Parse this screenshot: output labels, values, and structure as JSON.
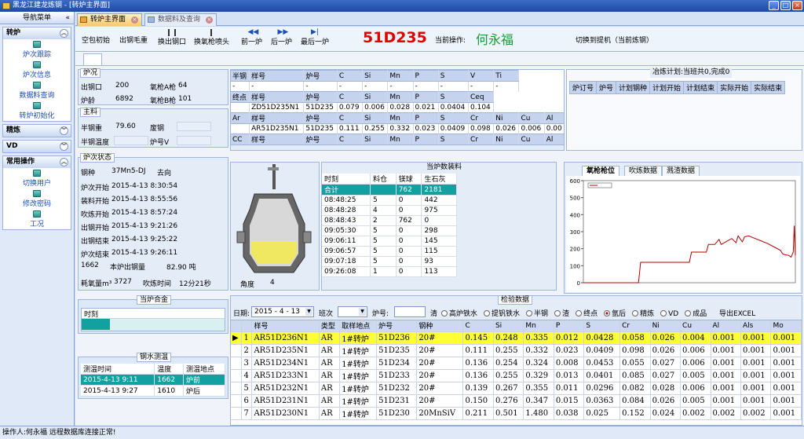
{
  "window": {
    "title": "黑龙江建龙炼钢 - [转炉主界面]"
  },
  "sidebar": {
    "title": "导航菜单",
    "groups": [
      {
        "label": "转炉",
        "items": [
          "炉次跟踪",
          "炉次信息",
          "数据料查询",
          "转炉初始化"
        ]
      },
      {
        "label": "精炼",
        "items": []
      },
      {
        "label": "VD",
        "items": []
      },
      {
        "label": "常用操作",
        "items": [
          "切换用户",
          "修改密码",
          "工况"
        ]
      }
    ]
  },
  "tabs": [
    {
      "label": "转炉主界面"
    },
    {
      "label": "数据料及查询"
    }
  ],
  "toolbar": {
    "buttons": [
      "空包初始",
      "出钢毛重",
      "换出钢口",
      "换氧枪喷头",
      "前一炉",
      "后一炉",
      "最后一炉"
    ],
    "heat_no": "51D235",
    "operator_label": "当前操作:",
    "operator": "何永福",
    "switch_label": "切换到提机（当前炼钢）"
  },
  "furnace_status": {
    "title": "炉况",
    "tap_label": "出钢口",
    "tap_value": "200",
    "lance_label": "氧枪A枪",
    "lance_value": "64",
    "age_label": "炉龄",
    "age_value": "6892",
    "lanceb_label": "氧枪B枪",
    "lanceb_value": "101"
  },
  "main_material": {
    "title": "主料",
    "hm_label": "半钢重",
    "hm_value": "79.60",
    "scrap_label": "废钢",
    "scrap_value": "",
    "temp_label": "半钢温度",
    "temp_value": "",
    "furnace_label": "炉号V",
    "furnace_value": ""
  },
  "heat_state": {
    "title": "炉次状态",
    "grade_label": "钢种",
    "grade_value": "37Mn5-DJ",
    "dest_label": "去向",
    "dest_value": "",
    "rows": [
      {
        "label": "炉次开始",
        "value": "2015-4-13 8:30:54"
      },
      {
        "label": "装料开始",
        "value": "2015-4-13 8:55:56"
      },
      {
        "label": "吹炼开始",
        "value": "2015-4-13 8:57:24"
      },
      {
        "label": "出钢开始",
        "value": "2015-4-13 9:21:26"
      },
      {
        "label": "出钢结束",
        "value": "2015-4-13 9:25:22"
      },
      {
        "label": "炉次结束",
        "value": "2015-4-13 9:26:11"
      }
    ],
    "steel_label": "本炉出钢量",
    "steel_value": "1662",
    "steel_weight": "82.90 吨",
    "oxygen_label": "耗氧量m³",
    "oxygen_value": "3727",
    "blow_label": "吹炼时间",
    "blow_value": "12分21秒"
  },
  "composition": {
    "header": [
      "半钢",
      "样号",
      "炉号",
      "C",
      "Si",
      "Mn",
      "P",
      "S",
      "V",
      "Ti"
    ],
    "row1": [
      "-",
      "-",
      "-",
      "-",
      "-",
      "-",
      "-",
      "-",
      "-",
      "-"
    ],
    "end_header": [
      "终点",
      "样号",
      "炉号",
      "C",
      "Si",
      "Mn",
      "P",
      "S",
      "Ceq"
    ],
    "end_row": [
      "",
      "ZD51D235N1",
      "51D235",
      "0.079",
      "0.006",
      "0.028",
      "0.021",
      "0.0404",
      "0.104"
    ],
    "ar_header": [
      "Ar",
      "样号",
      "炉号",
      "C",
      "Si",
      "Mn",
      "P",
      "S",
      "Cr",
      "Ni",
      "Cu",
      "Al"
    ],
    "ar_row": [
      "",
      "AR51D235N1",
      "51D235",
      "0.111",
      "0.255",
      "0.332",
      "0.023",
      "0.0409",
      "0.098",
      "0.026",
      "0.006",
      "0.00"
    ],
    "cc_header": [
      "CC",
      "样号",
      "炉号",
      "C",
      "Si",
      "Mn",
      "P",
      "S",
      "Cr",
      "Ni",
      "Cu",
      "Al"
    ]
  },
  "smelting_plan": {
    "title": "冶炼计划:当班共0,完成0",
    "columns": [
      "炉订号",
      "炉号",
      "计划钢种",
      "计划开始",
      "计划结束",
      "实际开始",
      "实际结束"
    ]
  },
  "converter": {
    "angle_label": "角度",
    "angle_value": "4"
  },
  "charge_data": {
    "title": "当炉数装料",
    "columns": [
      "时刻",
      "料仓",
      "镁球",
      "生石灰"
    ],
    "rows": [
      [
        "合计",
        "",
        "762",
        "2181"
      ],
      [
        "08:48:25",
        "5",
        "0",
        "442"
      ],
      [
        "08:48:28",
        "4",
        "0",
        "975"
      ],
      [
        "08:48:43",
        "2",
        "762",
        "0"
      ],
      [
        "09:05:30",
        "5",
        "0",
        "298"
      ],
      [
        "09:06:11",
        "5",
        "0",
        "145"
      ],
      [
        "09:06:57",
        "5",
        "0",
        "115"
      ],
      [
        "09:07:18",
        "5",
        "0",
        "93"
      ],
      [
        "09:26:08",
        "1",
        "0",
        "113"
      ]
    ]
  },
  "chart_tabs": [
    "氧枪枪位",
    "吹炼数据",
    "溅渣数据"
  ],
  "chart_data": {
    "type": "line",
    "title": "",
    "legend": "",
    "ylim": [
      0,
      600
    ],
    "yticks": [
      0,
      100,
      200,
      300,
      400,
      500,
      600
    ],
    "xticks": [],
    "series": [
      {
        "values": [
          [
            0,
            0
          ],
          [
            26,
            0
          ],
          [
            27,
            120
          ],
          [
            45,
            120
          ],
          [
            50,
            120
          ],
          [
            51,
            180
          ],
          [
            58,
            180
          ],
          [
            59,
            225
          ],
          [
            62,
            225
          ],
          [
            64,
            255
          ],
          [
            65,
            225
          ],
          [
            70,
            260
          ],
          [
            72,
            235
          ],
          [
            73,
            275
          ],
          [
            75,
            240
          ],
          [
            76,
            270
          ],
          [
            78,
            275
          ],
          [
            81,
            260
          ],
          [
            84,
            245
          ],
          [
            87,
            230
          ],
          [
            90,
            210
          ],
          [
            93,
            190
          ],
          [
            94,
            170
          ],
          [
            95,
            165
          ],
          [
            97,
            160
          ],
          [
            98,
            150
          ],
          [
            99,
            180
          ],
          [
            99.5,
            335
          ],
          [
            100,
            160
          ]
        ]
      }
    ]
  },
  "alloy": {
    "title": "当炉合金",
    "columns": [
      "时刻"
    ]
  },
  "temperature": {
    "title": "钢水测温",
    "columns": [
      "测温时间",
      "温度",
      "测温地点"
    ],
    "rows": [
      [
        "2015-4-13 9:11",
        "1662",
        "炉前"
      ],
      [
        "2015-4-13 9:27",
        "1610",
        "炉后"
      ]
    ]
  },
  "inspection": {
    "title": "检验数据",
    "date_label": "日期:",
    "date_value": "2015 - 4 - 13",
    "shift_label": "班次",
    "furnace_label": "炉号:",
    "clear_label": "清",
    "options": [
      "高炉铁水",
      "提钒铁水",
      "半钢",
      "渣",
      "终点",
      "氩后",
      "精炼",
      "VD",
      "成品"
    ],
    "selected": "氩后",
    "export_label": "导出EXCEL",
    "columns": [
      "样号",
      "类型",
      "取样地点",
      "炉号",
      "钢种",
      "C",
      "Si",
      "Mn",
      "P",
      "S",
      "Cr",
      "Ni",
      "Cu",
      "Al",
      "Als",
      "Mo"
    ],
    "rows": [
      [
        "AR51D236N1",
        "AR",
        "1#转炉",
        "51D236",
        "20#",
        "0.145",
        "0.248",
        "0.335",
        "0.012",
        "0.0428",
        "0.058",
        "0.026",
        "0.004",
        "0.001",
        "0.001",
        "0.001"
      ],
      [
        "AR51D235N1",
        "AR",
        "1#转炉",
        "51D235",
        "20#",
        "0.111",
        "0.255",
        "0.332",
        "0.023",
        "0.0409",
        "0.098",
        "0.026",
        "0.006",
        "0.001",
        "0.001",
        "0.001"
      ],
      [
        "AR51D234N1",
        "AR",
        "1#转炉",
        "51D234",
        "20#",
        "0.136",
        "0.254",
        "0.324",
        "0.008",
        "0.0453",
        "0.055",
        "0.027",
        "0.006",
        "0.001",
        "0.001",
        "0.001"
      ],
      [
        "AR51D233N1",
        "AR",
        "1#转炉",
        "51D233",
        "20#",
        "0.136",
        "0.255",
        "0.329",
        "0.013",
        "0.0401",
        "0.085",
        "0.027",
        "0.005",
        "0.001",
        "0.001",
        "0.001"
      ],
      [
        "AR51D232N1",
        "AR",
        "1#转炉",
        "51D232",
        "20#",
        "0.139",
        "0.267",
        "0.355",
        "0.011",
        "0.0296",
        "0.082",
        "0.028",
        "0.006",
        "0.001",
        "0.001",
        "0.001"
      ],
      [
        "AR51D231N1",
        "AR",
        "1#转炉",
        "51D231",
        "20#",
        "0.150",
        "0.276",
        "0.347",
        "0.015",
        "0.0363",
        "0.084",
        "0.026",
        "0.005",
        "0.001",
        "0.001",
        "0.001"
      ],
      [
        "AR51D230N1",
        "AR",
        "1#转炉",
        "51D230",
        "20MnSiV",
        "0.211",
        "0.501",
        "1.480",
        "0.038",
        "0.025",
        "0.152",
        "0.024",
        "0.002",
        "0.002",
        "0.002",
        "0.001"
      ]
    ]
  },
  "statusbar": {
    "text": "操作人:何永福 远程数据库连接正常!"
  }
}
